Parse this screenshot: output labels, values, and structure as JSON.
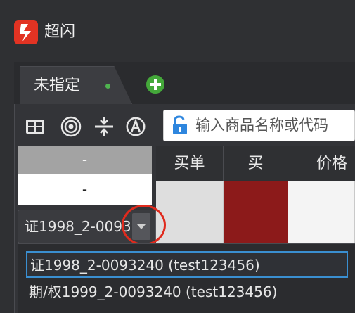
{
  "app": {
    "title": "超闪"
  },
  "tabs": [
    {
      "label": "未指定",
      "status_color": "#4fb34f"
    }
  ],
  "toolbar": {
    "icons": [
      "grid-icon",
      "target-icon",
      "split-icon",
      "circle-a-icon"
    ],
    "search": {
      "placeholder": "输入商品名称或代码",
      "lock_color": "#2e86de"
    }
  },
  "selector": {
    "header": "-",
    "value": "-"
  },
  "order_table": {
    "columns": [
      "买单",
      "买",
      "价格"
    ],
    "buy_color": "#8c1a1a"
  },
  "account": {
    "selected_text": "证1998_2-0093240 (test123456)",
    "options": [
      "证1998_2-0093240 (test123456)",
      "期/权1999_2-0093240 (test123456)"
    ]
  },
  "colors": {
    "brand": "#e23323",
    "highlight_ring": "#e02a1d",
    "selected_border": "#3a8fd1",
    "add_button": "#44a83a"
  }
}
